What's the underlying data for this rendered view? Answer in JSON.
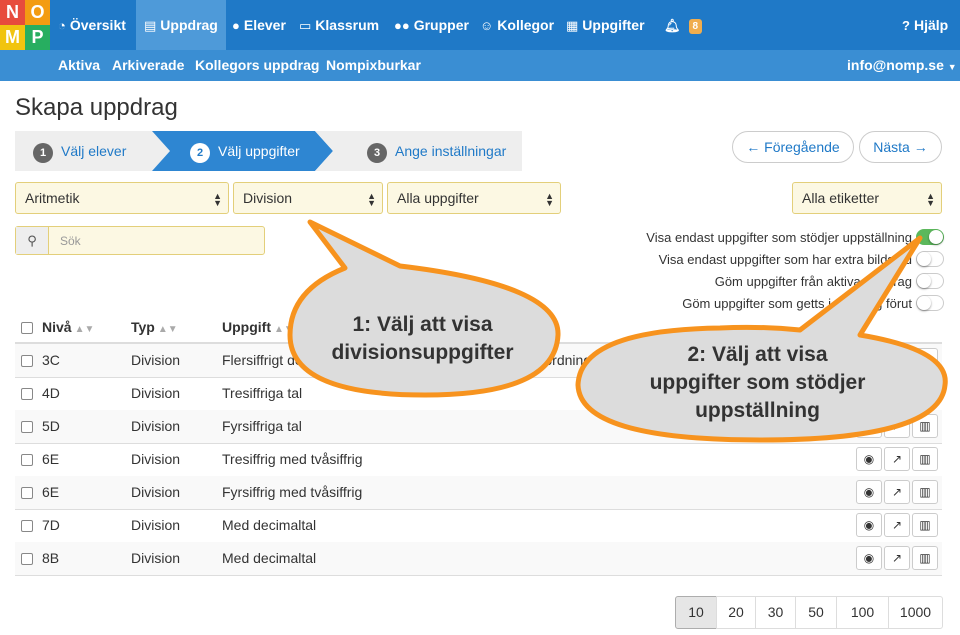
{
  "logo": {
    "letters": [
      "N",
      "O",
      "M",
      "P"
    ],
    "colors": [
      "#e74c3c",
      "#f39c12",
      "#f1c40f",
      "#27ae60"
    ]
  },
  "nav": {
    "items": [
      {
        "icon": "dashboard-icon",
        "label": "Översikt"
      },
      {
        "icon": "book-icon",
        "label": "Uppdrag"
      },
      {
        "icon": "user-icon",
        "label": "Elever"
      },
      {
        "icon": "monitor-icon",
        "label": "Klassrum"
      },
      {
        "icon": "users-icon",
        "label": "Grupper"
      },
      {
        "icon": "smiley-icon",
        "label": "Kollegor"
      },
      {
        "icon": "grid-icon",
        "label": "Uppgifter"
      }
    ],
    "notifications": "8",
    "help": "Hjälp"
  },
  "subnav": {
    "items": [
      "Aktiva",
      "Arkiverade",
      "Kollegors uppdrag",
      "Nompixburkar"
    ],
    "account": "info@nomp.se"
  },
  "page_title": "Skapa uppdrag",
  "steps": [
    {
      "num": "1",
      "label": "Välj elever"
    },
    {
      "num": "2",
      "label": "Välj uppgifter"
    },
    {
      "num": "3",
      "label": "Ange inställningar"
    }
  ],
  "buttons": {
    "prev": "← Föregående",
    "next": "Nästa →"
  },
  "filters": {
    "area": "Aritmetik",
    "topic": "Division",
    "tasks": "Alla uppgifter",
    "tags": "Alla etiketter"
  },
  "search": {
    "placeholder": "Sök"
  },
  "toggles": [
    {
      "label": "Visa endast uppgifter som stödjer uppställning",
      "on": true
    },
    {
      "label": "Visa endast uppgifter som har extra bildstöd",
      "on": false
    },
    {
      "label": "Göm uppgifter från aktiva uppdrag",
      "on": false
    },
    {
      "label": "Göm uppgifter som getts i uppdrag förut",
      "on": false
    }
  ],
  "table": {
    "headers": {
      "level": "Nivå",
      "type": "Typ",
      "task": "Uppgift"
    },
    "rows": [
      {
        "level": "3C",
        "type": "Division",
        "task": "Flersiffrigt delat med ensiffrigt i multiplikationstabellsordning"
      },
      {
        "level": "4D",
        "type": "Division",
        "task": "Tresiffriga tal"
      },
      {
        "level": "5D",
        "type": "Division",
        "task": "Fyrsiffriga tal"
      },
      {
        "level": "6E",
        "type": "Division",
        "task": "Tresiffrig med tvåsiffrig"
      },
      {
        "level": "6E",
        "type": "Division",
        "task": "Fyrsiffrig med tvåsiffrig"
      },
      {
        "level": "7D",
        "type": "Division",
        "task": "Med decimaltal"
      },
      {
        "level": "8B",
        "type": "Division",
        "task": "Med decimaltal"
      }
    ]
  },
  "pagination": [
    "10",
    "20",
    "30",
    "50",
    "100",
    "1000"
  ],
  "callouts": [
    {
      "line1": "1: Välj att visa",
      "line2": "divisionsuppgifter"
    },
    {
      "line1": "2: Välj att visa",
      "line2": "uppgifter som stödjer",
      "line3": "uppställning"
    }
  ],
  "colors": {
    "nav": "#1f79c7",
    "subnav": "#3a8ed3",
    "callout_fill": "#dcdcdc",
    "callout_stroke": "#f7931e",
    "toggle_on": "#5cb85c"
  }
}
